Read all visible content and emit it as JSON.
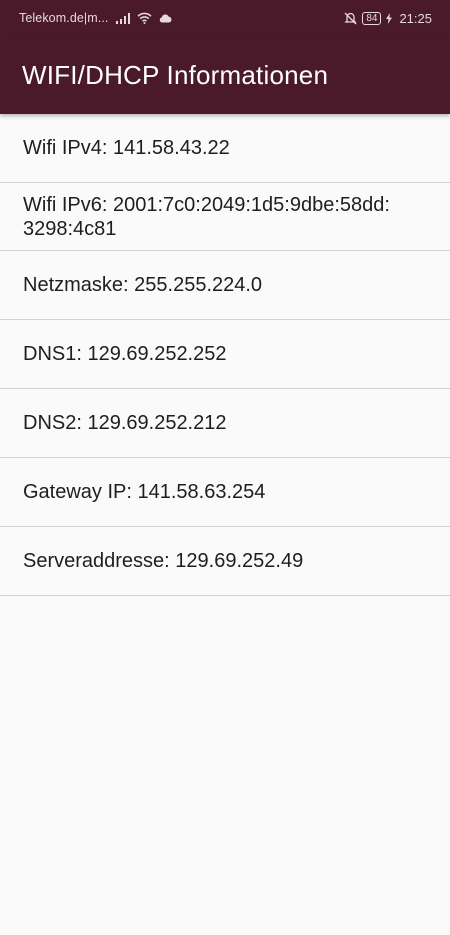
{
  "status_bar": {
    "carrier": "Telekom.de|m...",
    "battery": "84",
    "time": "21:25",
    "icons": [
      "signal-bars-icon",
      "wifi-icon",
      "cloud-icon",
      "mute-icon",
      "battery-icon",
      "charging-icon"
    ]
  },
  "app_bar": {
    "title": "WIFI/DHCP Informationen"
  },
  "info": {
    "items": [
      {
        "text": "Wifi IPv4: 141.58.43.22"
      },
      {
        "text": "Wifi IPv6: 2001:7c0:2049:1d5:9dbe:58dd:\n3298:4c81"
      },
      {
        "text": "Netzmaske: 255.255.224.0"
      },
      {
        "text": "DNS1: 129.69.252.252"
      },
      {
        "text": "DNS2: 129.69.252.212"
      },
      {
        "text": "Gateway IP: 141.58.63.254"
      },
      {
        "text": "Serveraddresse: 129.69.252.49"
      }
    ]
  },
  "colors": {
    "primary": "#4a1a2b",
    "background": "#fafafa",
    "divider": "#d4d4d4",
    "text": "#1e1e1e"
  }
}
